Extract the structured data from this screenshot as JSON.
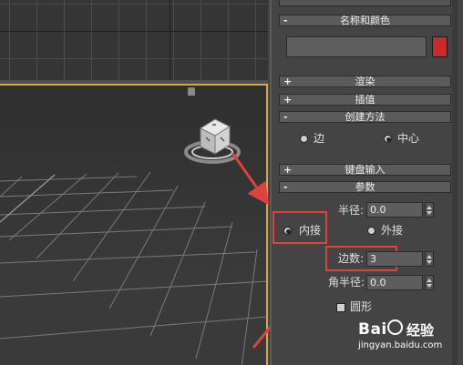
{
  "panel": {
    "name_color_rollout": "名称和颜色",
    "render_rollout": "渲染",
    "interpolation_rollout": "插值",
    "creation_method_rollout": "创建方法",
    "creation_method": {
      "edge": "边",
      "center": "中心",
      "selected": "center"
    },
    "keyboard_input_rollout": "键盘输入",
    "parameters_rollout": "参数",
    "radius": {
      "label": "半径:",
      "value": "0.0"
    },
    "inscribed": {
      "label": "内接",
      "selected": true
    },
    "circumscribed": {
      "label": "外接",
      "selected": false
    },
    "sides": {
      "label": "边数:",
      "value": "3"
    },
    "corner_radius": {
      "label": "角半径:",
      "value": "0.0"
    },
    "circular": {
      "label": "圆形",
      "checked": false
    },
    "signs": {
      "collapse": "-",
      "expand": "+"
    },
    "object_color": "#cc2a2a"
  },
  "watermark": {
    "brand": "Bai",
    "brand_suffix": "经验",
    "url": "jingyan.baidu.com"
  },
  "colors": {
    "highlight": "#e0413b",
    "viewport_border": "#d2a94a"
  }
}
